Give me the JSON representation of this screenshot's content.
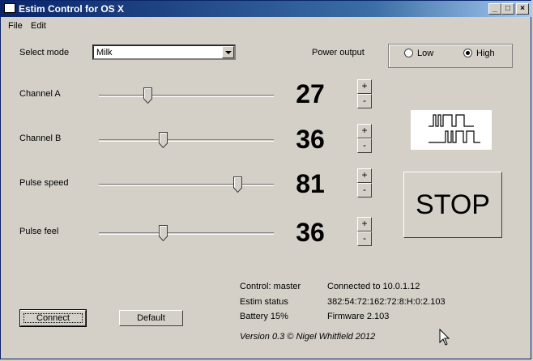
{
  "window": {
    "title": "Estim Control for OS X"
  },
  "menu": {
    "file": "File",
    "edit": "Edit"
  },
  "mode": {
    "label": "Select mode",
    "value": "Milk"
  },
  "power": {
    "label": "Power output",
    "options": [
      "Low",
      "High"
    ],
    "selected": "High"
  },
  "channels": [
    {
      "label": "Channel A",
      "value": "27",
      "level": 27
    },
    {
      "label": "Channel B",
      "value": "36",
      "level": 36
    },
    {
      "label": "Pulse speed",
      "value": "81",
      "level": 81
    },
    {
      "label": "Pulse feel",
      "value": "36",
      "level": 36
    }
  ],
  "stepper": {
    "plus": "+",
    "minus": "-"
  },
  "stop_label": "STOP",
  "status": {
    "control_label": "Control: master",
    "connection": "Connected to 10.0.1.12",
    "estim_label": "Estim status",
    "estim_value": "382:54:72:162:72:8:H:0:2.103",
    "battery": "Battery 15%",
    "firmware": "Firmware 2.103"
  },
  "buttons": {
    "connect": "Connect",
    "default": "Default"
  },
  "version": "Version 0.3 © Nigel Whitfield 2012"
}
